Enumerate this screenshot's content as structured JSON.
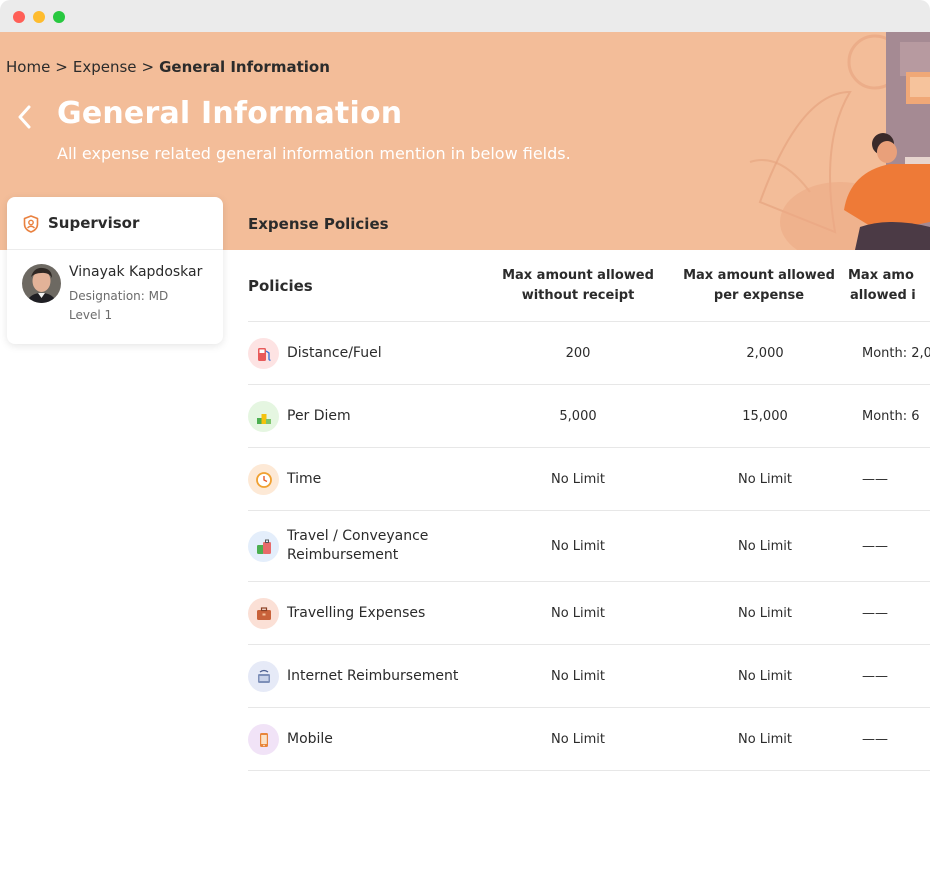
{
  "breadcrumb": {
    "items": [
      "Home",
      "Expense"
    ],
    "current": "General Information",
    "separator": ">"
  },
  "header": {
    "title": "General Information",
    "subtitle": "All expense related general information mention in below fields."
  },
  "supervisor": {
    "heading": "Supervisor",
    "name": "Vinayak Kapdoskar",
    "designation": "Designation: MD",
    "level": "Level 1"
  },
  "policies_section": {
    "title": "Expense Policies",
    "columns": {
      "policies": "Policies",
      "c1_line1": "Max amount allowed",
      "c1_line2": "without receipt",
      "c2_line1": "Max amount allowed",
      "c2_line2": "per expense",
      "c3_line1": "Max amo",
      "c3_line2": "allowed i"
    },
    "rows": [
      {
        "label": "Distance/Fuel",
        "icon": "fuel-pump-icon",
        "c1": "200",
        "c2": "2,000",
        "c3": "Month: 2,0"
      },
      {
        "label": "Per Diem",
        "icon": "podium-icon",
        "c1": "5,000",
        "c2": "15,000",
        "c3": "Month: 6"
      },
      {
        "label": "Time",
        "icon": "clock-icon",
        "c1": "No Limit",
        "c2": "No Limit",
        "c3": "——"
      },
      {
        "label_line1": "Travel / Conveyance",
        "label_line2": "Reimbursement",
        "icon": "luggage-icon",
        "c1": "No Limit",
        "c2": "No Limit",
        "c3": "——"
      },
      {
        "label": "Travelling Expenses",
        "icon": "briefcase-icon",
        "c1": "No Limit",
        "c2": "No Limit",
        "c3": "——"
      },
      {
        "label": "Internet Reimbursement",
        "icon": "router-icon",
        "c1": "No Limit",
        "c2": "No Limit",
        "c3": "——"
      },
      {
        "label": "Mobile",
        "icon": "mobile-phone-icon",
        "c1": "No Limit",
        "c2": "No Limit",
        "c3": "——"
      }
    ]
  },
  "colors": {
    "hero": "#f3bd99",
    "accent": "#e9813f",
    "window_bar": "#ebebeb"
  }
}
